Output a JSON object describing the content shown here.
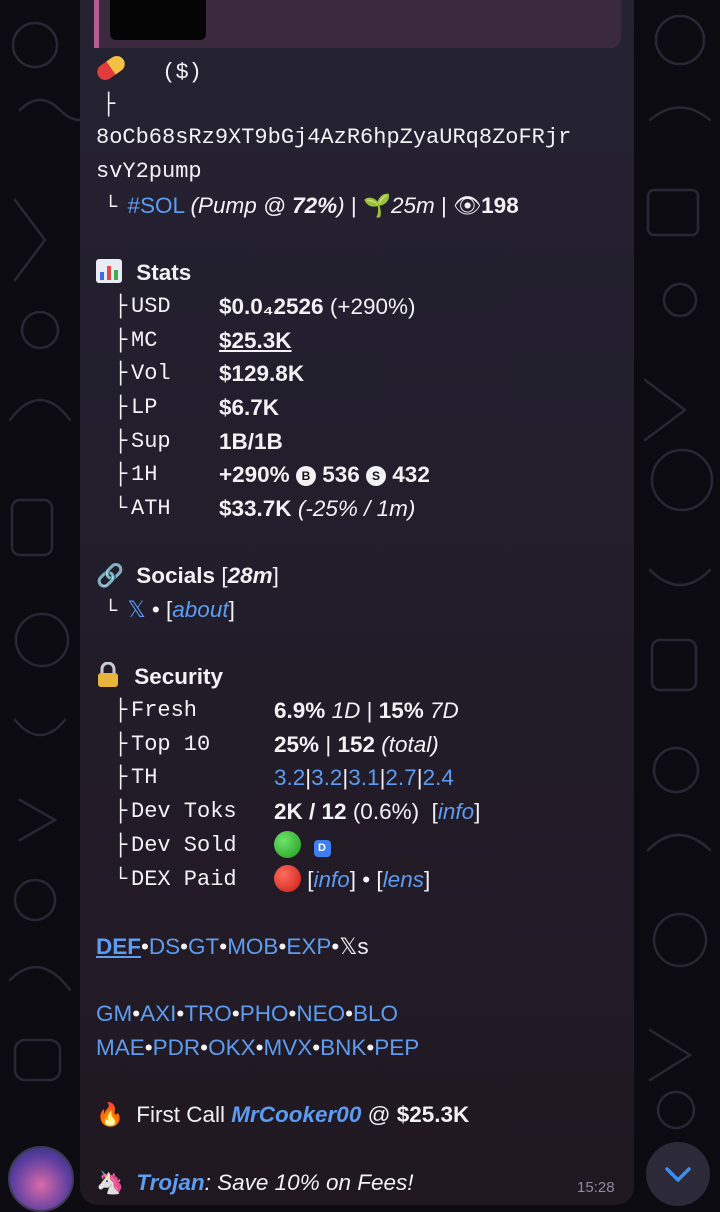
{
  "message": {
    "header": {
      "ticker": "($)",
      "tree_mid": "├",
      "tree_end": "└"
    },
    "address_line1": "8oCb68sRz9XT9bGj4AzR6hpZyaURq8ZoFRjr",
    "address_line2": "svY2pump",
    "chain_tag": "#SOL",
    "pump_open": "(Pump @ ",
    "pump_pct": "72%",
    "pump_close": ")",
    "sep": "|",
    "age": "25m",
    "views": "198",
    "stats": {
      "title": "Stats",
      "rows": [
        {
          "key": "USD",
          "value": "$0.0₄2526",
          "extra": "(+290%)"
        },
        {
          "key": "MC",
          "value": "$25.3K"
        },
        {
          "key": "Vol",
          "value": "$129.8K"
        },
        {
          "key": "LP",
          "value": "$6.7K"
        },
        {
          "key": "Sup",
          "value": "1B/1B"
        },
        {
          "key": "1H",
          "value": "+290%",
          "buys": "536",
          "sells": "432",
          "buy_icon": "B",
          "sell_icon": "S"
        },
        {
          "key": "ATH",
          "value": "$33.7K",
          "extra": "(-25% / 1m)"
        }
      ]
    },
    "socials": {
      "title": "Socials",
      "age_open": "[",
      "age": "28m",
      "age_close": "]",
      "x_link": "𝕏",
      "dot": "•",
      "about_link": "about"
    },
    "security": {
      "title": "Security",
      "fresh_key": "Fresh",
      "fresh_1d": "6.9%",
      "fresh_1d_label": "1D",
      "fresh_7d": "15%",
      "fresh_7d_label": "7D",
      "top10_key": "Top 10",
      "top10_pct": "25%",
      "top10_count": "152",
      "top10_label": "(total)",
      "th_key": "TH",
      "th_values": [
        "3.2",
        "3.2",
        "3.1",
        "2.7",
        "2.4"
      ],
      "devtoks_key": "Dev Toks",
      "devtoks_value": "2K / 12",
      "devtoks_pct": "(0.6%)",
      "info_link": "info",
      "devsold_key": "Dev Sold",
      "devsold_badge": "D",
      "dexpaid_key": "DEX Paid",
      "lens_link": "lens"
    },
    "links_row1": [
      "DEF",
      "DS",
      "GT",
      "MOB",
      "EXP"
    ],
    "links_row1_tail": "𝕏s",
    "links_row2": [
      "GM",
      "AXI",
      "TRO",
      "PHO",
      "NEO",
      "BLO"
    ],
    "links_row3": [
      "MAE",
      "PDR",
      "OKX",
      "MVX",
      "BNK",
      "PEP"
    ],
    "first_call": {
      "label": "First Call",
      "user": "MrCooker00",
      "at": "@",
      "mc": "$25.3K"
    },
    "promo": {
      "name": "Trojan",
      "text": ": Save 10% on Fees!"
    },
    "time": "15:28"
  },
  "colors": {
    "link": "#5d9cf0",
    "bubble": "#231f2d",
    "background": "#0d0b12",
    "reply_accent": "#b55c95"
  },
  "icons": [
    "pill-icon",
    "chart-icon",
    "link-icon",
    "lock-icon",
    "fire-icon",
    "unicorn-icon",
    "seedling-icon",
    "eye-icon",
    "chevron-down-icon"
  ]
}
